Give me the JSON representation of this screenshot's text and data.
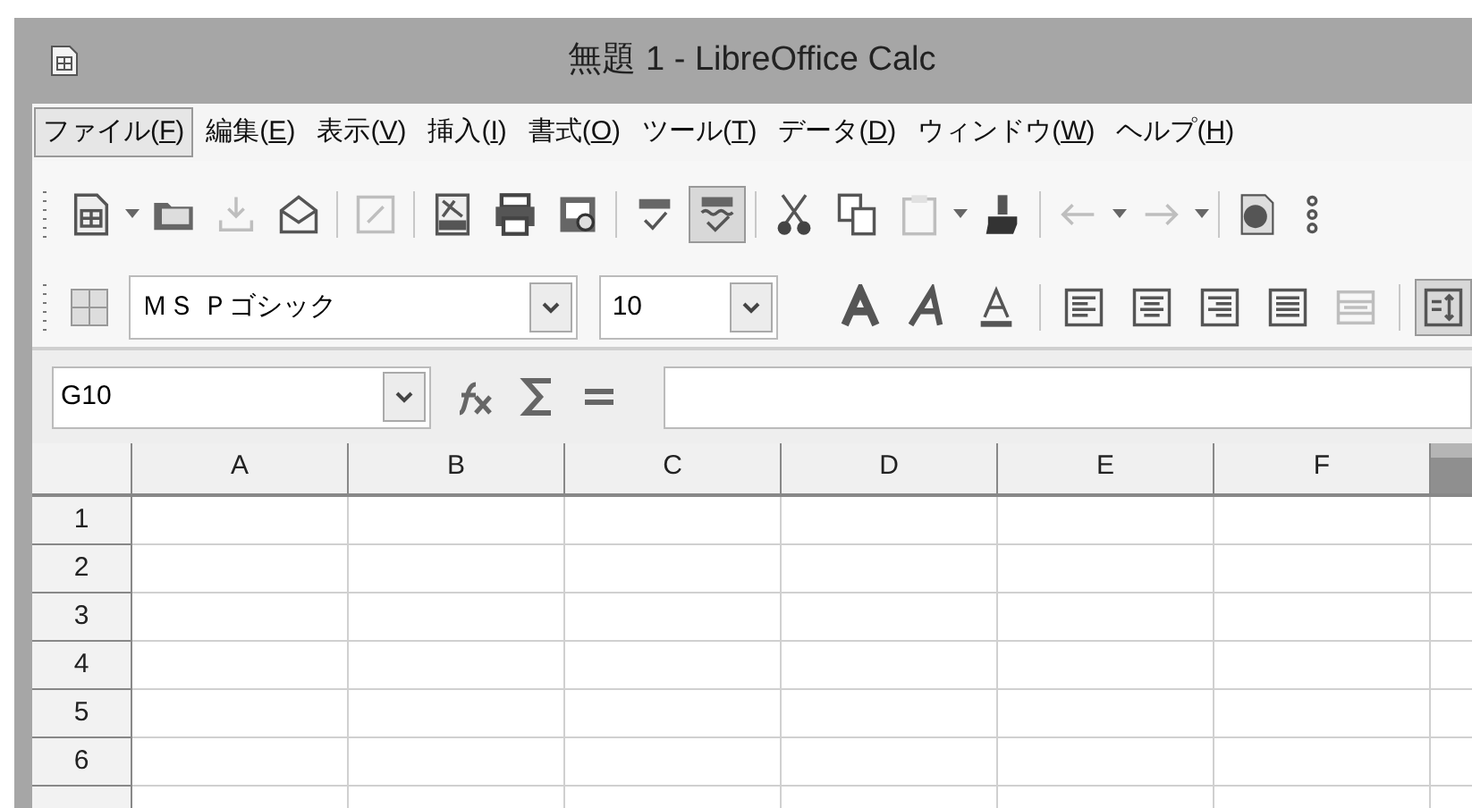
{
  "window": {
    "title": "無題 1 - LibreOffice Calc"
  },
  "menu": [
    {
      "before": "ファイル(",
      "key": "F",
      "after": ")",
      "selected": true
    },
    {
      "before": "編集(",
      "key": "E",
      "after": ")",
      "selected": false
    },
    {
      "before": "表示(",
      "key": "V",
      "after": ")",
      "selected": false
    },
    {
      "before": "挿入(",
      "key": "I",
      "after": ")",
      "selected": false
    },
    {
      "before": "書式(",
      "key": "O",
      "after": ")",
      "selected": false
    },
    {
      "before": "ツール(",
      "key": "T",
      "after": ")",
      "selected": false
    },
    {
      "before": "データ(",
      "key": "D",
      "after": ")",
      "selected": false
    },
    {
      "before": "ウィンドウ(",
      "key": "W",
      "after": ")",
      "selected": false
    },
    {
      "before": "ヘルプ(",
      "key": "H",
      "after": ")",
      "selected": false
    }
  ],
  "standard_toolbar": [
    {
      "kind": "button",
      "disabled": false,
      "pressed": false
    },
    {
      "kind": "arrow"
    },
    {
      "kind": "button",
      "disabled": false,
      "pressed": false
    },
    {
      "kind": "button",
      "disabled": true,
      "pressed": false
    },
    {
      "kind": "button",
      "disabled": false,
      "pressed": false
    },
    {
      "kind": "separator"
    },
    {
      "kind": "button",
      "disabled": true,
      "pressed": false
    },
    {
      "kind": "separator"
    },
    {
      "kind": "button",
      "disabled": false,
      "pressed": false
    },
    {
      "kind": "button",
      "disabled": false,
      "pressed": false
    },
    {
      "kind": "button",
      "disabled": false,
      "pressed": false
    },
    {
      "kind": "separator"
    },
    {
      "kind": "button",
      "disabled": false,
      "pressed": false
    },
    {
      "kind": "button",
      "disabled": false,
      "pressed": true
    },
    {
      "kind": "separator"
    },
    {
      "kind": "button",
      "disabled": false,
      "pressed": false
    },
    {
      "kind": "button",
      "disabled": false,
      "pressed": false
    },
    {
      "kind": "button",
      "disabled": true,
      "pressed": false
    },
    {
      "kind": "arrow"
    },
    {
      "kind": "button",
      "disabled": false,
      "pressed": false
    },
    {
      "kind": "separator"
    },
    {
      "kind": "button",
      "disabled": true,
      "pressed": false
    },
    {
      "kind": "arrow"
    },
    {
      "kind": "button",
      "disabled": true,
      "pressed": false
    },
    {
      "kind": "arrow"
    },
    {
      "kind": "separator"
    },
    {
      "kind": "button",
      "disabled": false,
      "pressed": false
    },
    {
      "kind": "button",
      "disabled": false,
      "pressed": false
    }
  ],
  "formatting_toolbar": {
    "font_name": "ＭＳ Ｐゴシック",
    "font_size": "10",
    "buttons": [
      {
        "kind": "button",
        "disabled": false,
        "pressed": false
      },
      {
        "kind": "button",
        "disabled": false,
        "pressed": false
      },
      {
        "kind": "button",
        "disabled": false,
        "pressed": false
      },
      {
        "kind": "separator"
      },
      {
        "kind": "button",
        "disabled": false,
        "pressed": false
      },
      {
        "kind": "button",
        "disabled": false,
        "pressed": false
      },
      {
        "kind": "button",
        "disabled": false,
        "pressed": false
      },
      {
        "kind": "button",
        "disabled": false,
        "pressed": false
      },
      {
        "kind": "button",
        "disabled": true,
        "pressed": false
      },
      {
        "kind": "separator"
      },
      {
        "kind": "button",
        "disabled": false,
        "pressed": true
      }
    ]
  },
  "formula_bar": {
    "name_box": "G10"
  },
  "sheet": {
    "columns": [
      {
        "label": "A",
        "selected": false
      },
      {
        "label": "B",
        "selected": false
      },
      {
        "label": "C",
        "selected": false
      },
      {
        "label": "D",
        "selected": false
      },
      {
        "label": "E",
        "selected": false
      },
      {
        "label": "F",
        "selected": false
      },
      {
        "selected": true
      }
    ],
    "rows": [
      {
        "label": "1"
      },
      {
        "label": "2"
      },
      {
        "label": "3"
      },
      {
        "label": "4"
      },
      {
        "label": "5"
      },
      {
        "label": "6"
      },
      {}
    ]
  }
}
